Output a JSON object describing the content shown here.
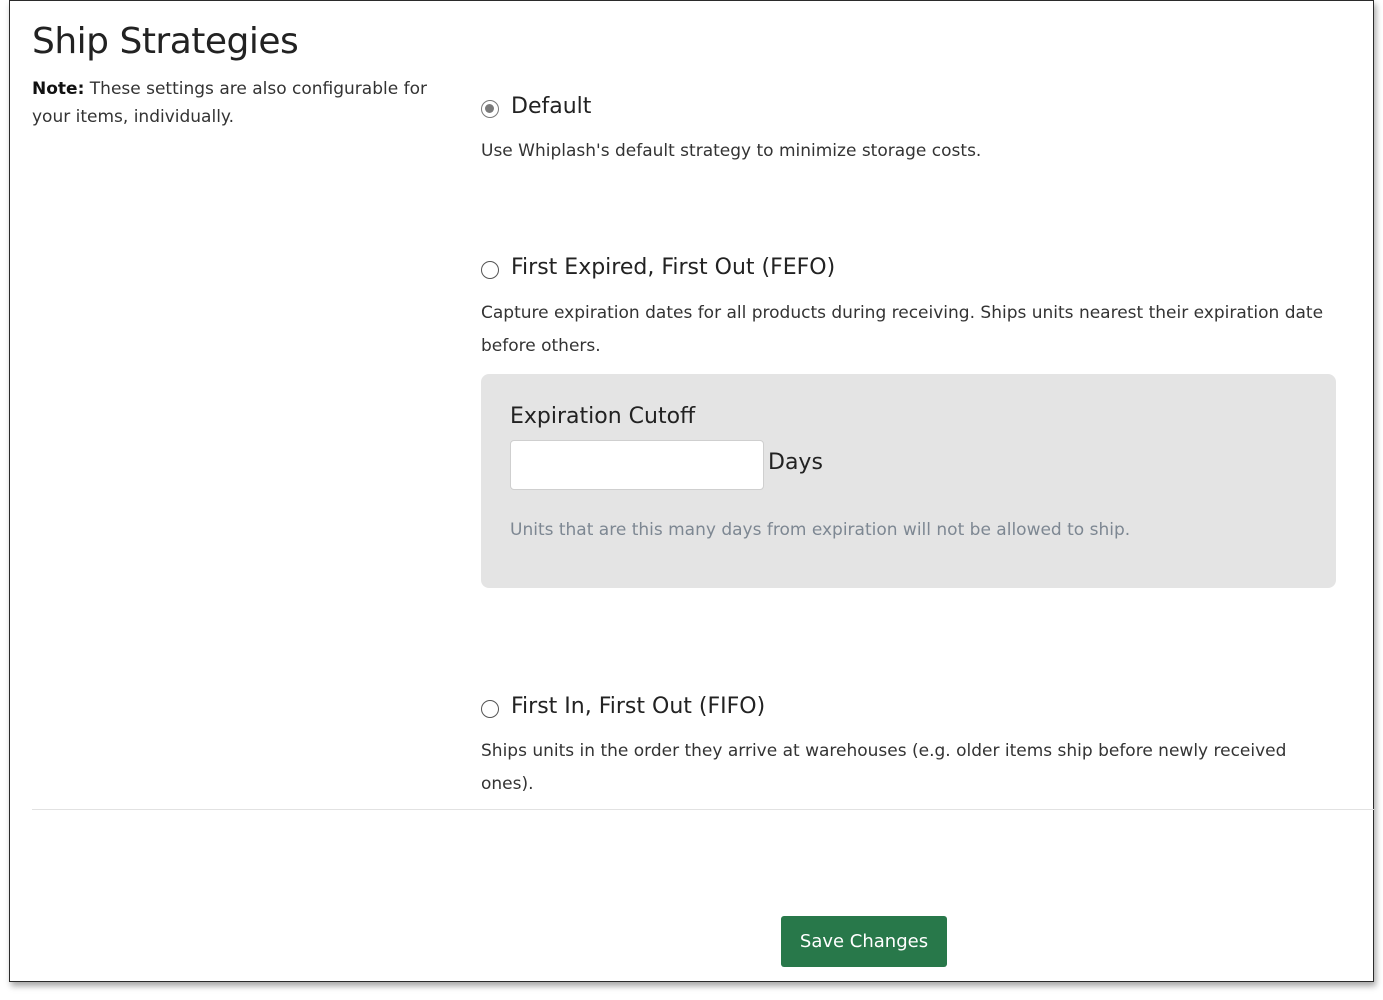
{
  "page": {
    "title": "Ship Strategies",
    "note_bold": "Note:",
    "note_text": " These settings are also configurable for your items, individually."
  },
  "options": [
    {
      "label": "Default",
      "description": "Use Whiplash's default strategy to minimize storage costs.",
      "selected": true
    },
    {
      "label": "First Expired, First Out (FEFO)",
      "description": "Capture expiration dates for all products during receiving. Ships units nearest their expiration date before others.",
      "selected": false
    },
    {
      "label": "First In, First Out (FIFO)",
      "description": "Ships units in the order they arrive at warehouses (e.g. older items ship before newly received ones).",
      "selected": false
    }
  ],
  "expiration_cutoff": {
    "title": "Expiration Cutoff",
    "value": "",
    "unit": "Days",
    "help": "Units that are this many days from expiration will not be allowed to ship."
  },
  "actions": {
    "save_label": "Save Changes"
  },
  "colors": {
    "save_button_bg": "#28784a",
    "panel_bg": "#e4e4e4",
    "help_text": "#7d8792"
  }
}
